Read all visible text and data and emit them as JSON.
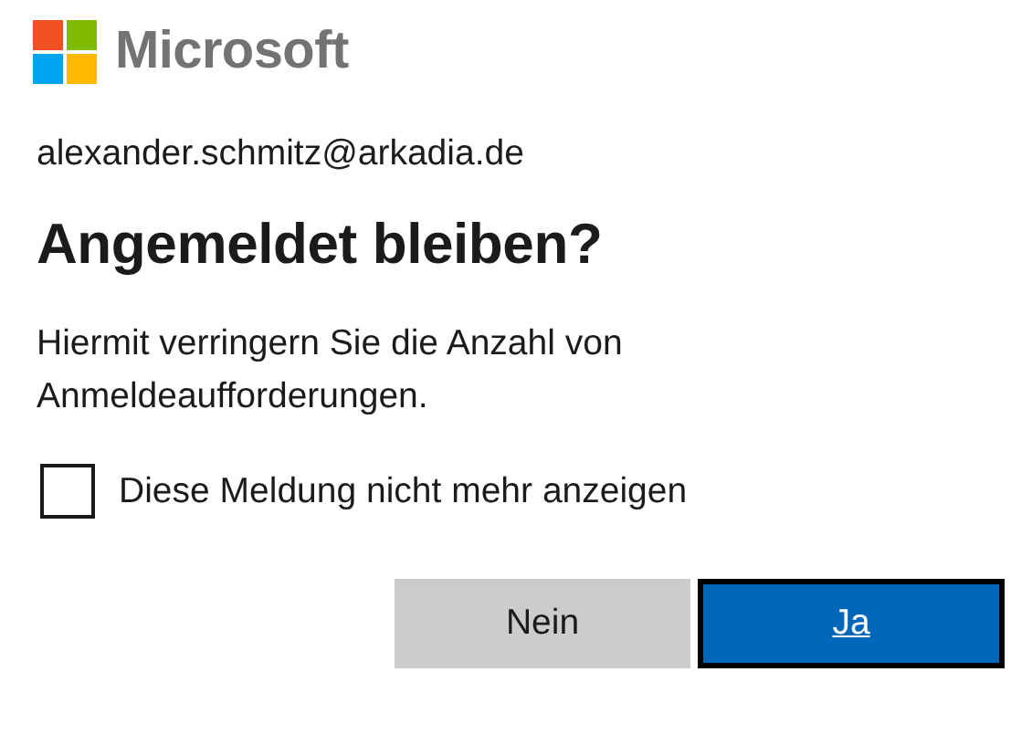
{
  "logo": {
    "name": "Microsoft"
  },
  "account": "alexander.schmitz@arkadia.de",
  "title": "Angemeldet bleiben?",
  "description": "Hiermit verringern Sie die Anzahl von Anmeldeaufforderungen.",
  "checkbox": {
    "label": "Diese Meldung nicht mehr anzeigen",
    "checked": false
  },
  "buttons": [
    {
      "label": "Nein",
      "kind": "secondary",
      "focused": false
    },
    {
      "label": "Ja",
      "kind": "primary",
      "focused": true
    }
  ]
}
